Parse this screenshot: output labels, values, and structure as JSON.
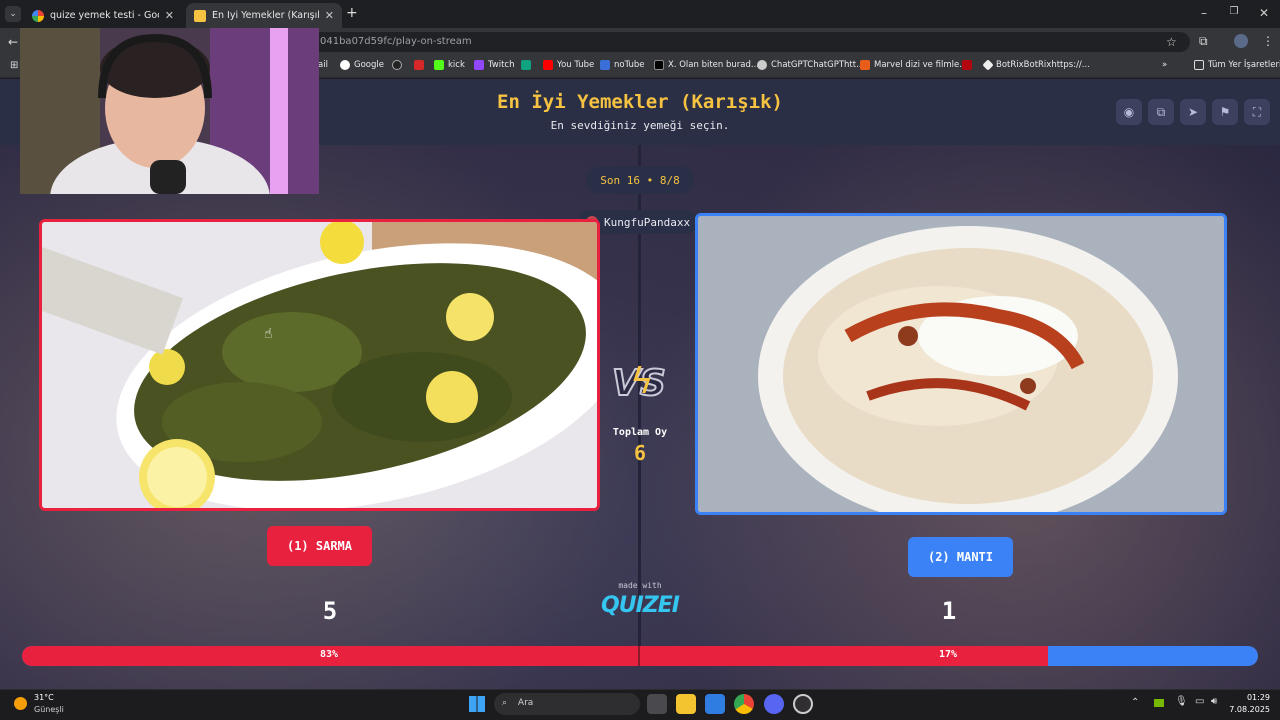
{
  "browser": {
    "tabs": [
      {
        "title": "quize yemek testi - Google'da A",
        "active": false
      },
      {
        "title": "En İyi Yemekler (Karışık) - Quize",
        "active": true
      }
    ],
    "url": "041ba07d59fc/play-on-stream",
    "bookmarks": [
      "ail",
      "Google",
      "kick",
      "Twitch",
      "You Tube",
      "noTube",
      "X. Olan biten burad...",
      "ChatGPTChatGPThtt...",
      "Marvel dizi ve filmle...",
      "BotRixBotRixhttps://..."
    ],
    "all_bookmarks_label": "Tüm Yer İşaretleri"
  },
  "quiz": {
    "title": "En İyi Yemekler (Karışık)",
    "subtitle": "En sevdiğiniz yemeği seçin.",
    "round": "Son 16 • 8/8",
    "streamer": "KungfuPandaxx",
    "vs_label": "VS",
    "total_votes_label": "Toplam Oy",
    "total_votes": "6",
    "made_with": "made with",
    "brand": "QUIZEI",
    "left": {
      "label": "(1) SARMA",
      "votes": "5",
      "percent": "83%",
      "share": 0.83
    },
    "right": {
      "label": "(2) MANTI",
      "votes": "1",
      "percent": "17%",
      "share": 0.17
    },
    "colors": {
      "left": "#e8213f",
      "right": "#3b82f6",
      "title": "#f5c242"
    }
  },
  "taskbar": {
    "weather_temp": "31°C",
    "weather_desc": "Güneşli",
    "search_placeholder": "Ara",
    "time": "01:29",
    "date": "7.08.2025"
  }
}
